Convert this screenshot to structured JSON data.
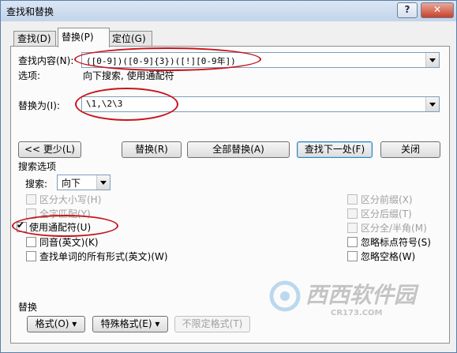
{
  "window": {
    "title": "查找和替换",
    "help": "?",
    "close": "✕"
  },
  "tabs": [
    {
      "label": "查找(D)",
      "active": false
    },
    {
      "label": "替换(P)",
      "active": true
    },
    {
      "label": "定位(G)",
      "active": false
    }
  ],
  "find": {
    "label": "查找内容(N):",
    "value": "([0-9])([0-9]{3})([!][0-9年])"
  },
  "options": {
    "label": "选项:",
    "value": "向下搜索, 使用通配符"
  },
  "replace": {
    "label": "替换为(I):",
    "value": "\\1,\\2\\3"
  },
  "buttons": {
    "less": "<< 更少(L)",
    "replace": "替换(R)",
    "replace_all": "全部替换(A)",
    "find_next": "查找下一处(F)",
    "close": "关闭"
  },
  "search_options": {
    "title": "搜索选项",
    "search_label": "搜索:",
    "search_value": "向下",
    "left": [
      {
        "label": "区分大小写(H)",
        "checked": false,
        "enabled": false
      },
      {
        "label": "全字匹配(Y)",
        "checked": false,
        "enabled": false
      },
      {
        "label": "使用通配符(U)",
        "checked": true,
        "enabled": true
      },
      {
        "label": "同音(英文)(K)",
        "checked": false,
        "enabled": true
      },
      {
        "label": "查找单词的所有形式(英文)(W)",
        "checked": false,
        "enabled": true
      }
    ],
    "right": [
      {
        "label": "区分前缀(X)",
        "checked": false,
        "enabled": false
      },
      {
        "label": "区分后缀(T)",
        "checked": false,
        "enabled": false
      },
      {
        "label": "区分全/半角(M)",
        "checked": false,
        "enabled": false
      },
      {
        "label": "忽略标点符号(S)",
        "checked": false,
        "enabled": true
      },
      {
        "label": "忽略空格(W)",
        "checked": false,
        "enabled": true
      }
    ]
  },
  "replace_section": {
    "title": "替换",
    "format": "格式(O)",
    "special": "特殊格式(E)",
    "no_format": "不限定格式(T)"
  },
  "watermark": {
    "brand": "西西软件园",
    "url": "CR173.COM"
  }
}
